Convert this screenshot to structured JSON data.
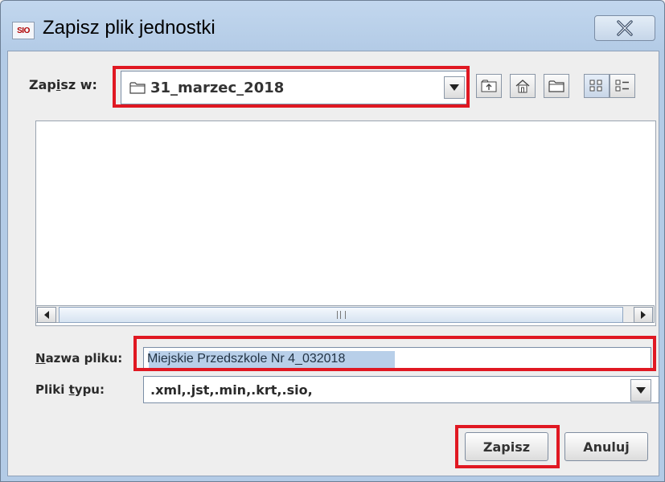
{
  "window": {
    "app_icon_text": "SIO",
    "title": "Zapisz plik jednostki"
  },
  "save_in": {
    "label_prefix": "Zap",
    "label_mnemonic": "i",
    "label_suffix": "sz w:",
    "folder": "31_marzec_2018"
  },
  "toolbar": {
    "icons": [
      "up-one-level-icon",
      "home-icon",
      "new-folder-icon",
      "list-view-icon",
      "details-view-icon"
    ]
  },
  "file_name": {
    "label_mnemonic": "N",
    "label_rest": "azwa pliku:",
    "value": "Miejskie Przedszkole Nr 4_032018"
  },
  "file_type": {
    "label_prefix": "Pliki ",
    "label_mnemonic": "t",
    "label_suffix": "ypu:",
    "value": ".xml,.jst,.min,.krt,.sio,"
  },
  "buttons": {
    "save": "Zapisz",
    "cancel": "Anuluj"
  },
  "colors": {
    "highlight_red": "#e01822",
    "selection": "#b8cfe9"
  }
}
